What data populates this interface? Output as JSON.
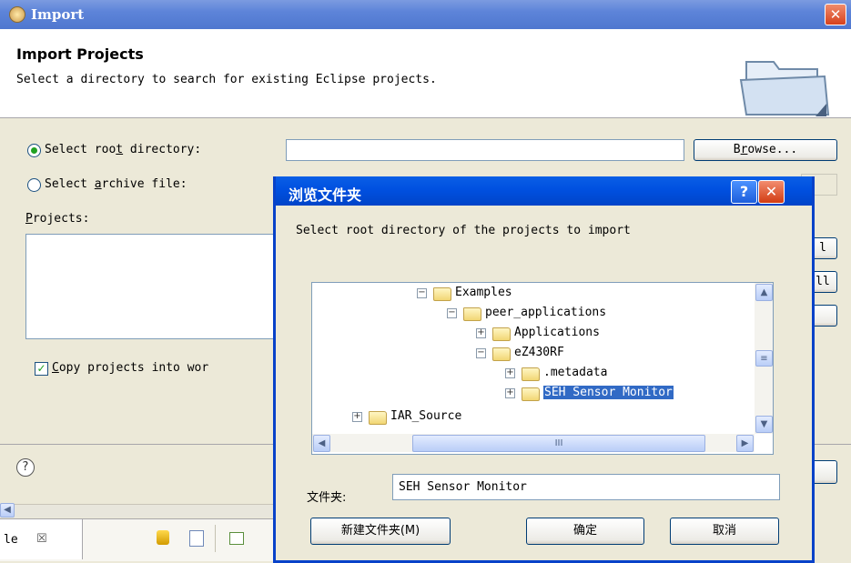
{
  "window": {
    "title": "Import",
    "close_label": "✕"
  },
  "header": {
    "title": "Import Projects",
    "subtitle": "Select a directory to search for existing Eclipse projects."
  },
  "options": {
    "root_dir_label": "Select roo",
    "root_dir_mnemonic": "t",
    "root_dir_rest": " directory:",
    "root_dir_value": "",
    "browse_label": "B",
    "browse_mnemonic": "r",
    "browse_rest": "owse...",
    "archive_label": "Select ",
    "archive_mnemonic": "a",
    "archive_rest": "rchive file:",
    "projects_mnemonic": "P",
    "projects_rest": "rojects:",
    "copy_mnemonic": "C",
    "copy_rest": "opy projects into wor",
    "copy_checked": true,
    "root_dir_selected": true,
    "side_button_1": "l",
    "side_button_2": "ll"
  },
  "help_icon": "?",
  "bottom_tab": {
    "label": "le",
    "close": "☒"
  },
  "dialog": {
    "title": "浏览文件夹",
    "help_label": "?",
    "close_label": "✕",
    "prompt": "Select root directory of the projects to import",
    "tree": [
      {
        "label": "Examples",
        "expander": "⊟",
        "level": 0
      },
      {
        "label": "peer_applications",
        "expander": "⊟",
        "level": 1
      },
      {
        "label": "Applications",
        "expander": "⊞",
        "level": 2
      },
      {
        "label": "eZ430RF",
        "expander": "⊟",
        "level": 2
      },
      {
        "label": ".metadata",
        "expander": "⊞",
        "level": 3
      },
      {
        "label": "SEH Sensor Monitor",
        "expander": "⊞",
        "level": 3,
        "selected": true
      },
      {
        "label": "IAR_Source",
        "expander": "⊞",
        "level": -1
      }
    ],
    "scroll_h_label": "III",
    "folder_label": "文件夹:",
    "folder_value": "SEH Sensor Monitor",
    "new_folder_label": "新建文件夹(M)",
    "ok_label": "确定",
    "cancel_label": "取消"
  },
  "colors": {
    "titlebar": "#5d84d9",
    "dialog_titlebar": "#0050e0",
    "selection": "#316ac5"
  }
}
